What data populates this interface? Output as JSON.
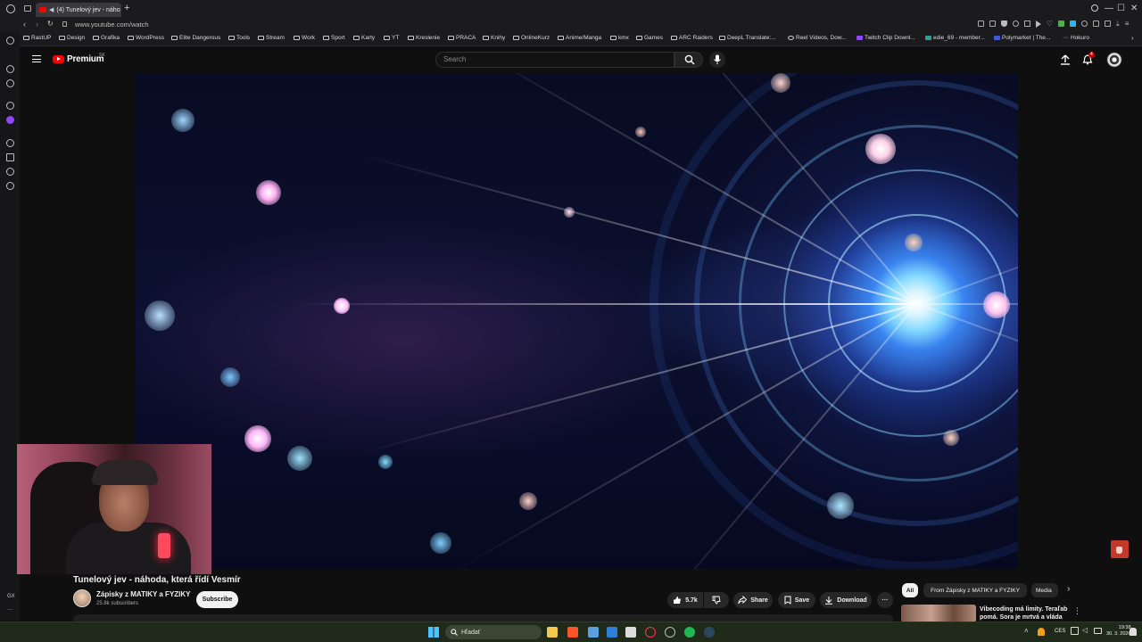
{
  "browser": {
    "tab_title": "(4) Tunelový jev - náho",
    "url": "www.youtube.com/watch",
    "window_controls": [
      "—",
      "☐",
      "✕"
    ],
    "bookmarks": [
      "RastUP",
      "Design",
      "Grafika",
      "WordPress",
      "Elite Dangerous",
      "Tools",
      "Stream",
      "Work",
      "Sport",
      "Karty",
      "YT",
      "Kreslenie",
      "PRACA",
      "Knihy",
      "OnlineKurz",
      "Anime/Manga",
      "kmx",
      "Games",
      "ARC Raiders",
      "DeepL Translate:...",
      "Reel Videos, Dow...",
      "Twitch Clip Downl...",
      "edie_69 - member...",
      "Polymarket | The...",
      "Hokuro"
    ]
  },
  "youtube": {
    "logo_text": "Premium",
    "logo_region": "SK",
    "search_placeholder": "Search",
    "notification_count": "4"
  },
  "video": {
    "title": "Tunelový jev - náhoda, která řídí Vesmír",
    "channel_name": "Zápisky z MATIKY a FYZIKY",
    "subscribers": "25.8k subscribers",
    "subscribe_label": "Subscribe",
    "like_count": "5.7k",
    "share_label": "Share",
    "save_label": "Save",
    "download_label": "Download",
    "more_label": "···"
  },
  "recommendations": {
    "chips": [
      "All",
      "From Zápisky z MATIKY a FYZIKY",
      "Media"
    ],
    "first_item_title": "Vibecoding má limity. Teraľab pomá. Sora je mrtvá a vláda"
  },
  "sidebar_bottom": {
    "label": "GX",
    "more": "···"
  },
  "taskbar": {
    "search_label": "Hľadať",
    "language": "CES",
    "time": "19:38",
    "date": "30. 3. 2026"
  },
  "colors": {
    "youtube_red": "#ff0000",
    "background": "#0f0f0f",
    "pill": "#272727"
  }
}
